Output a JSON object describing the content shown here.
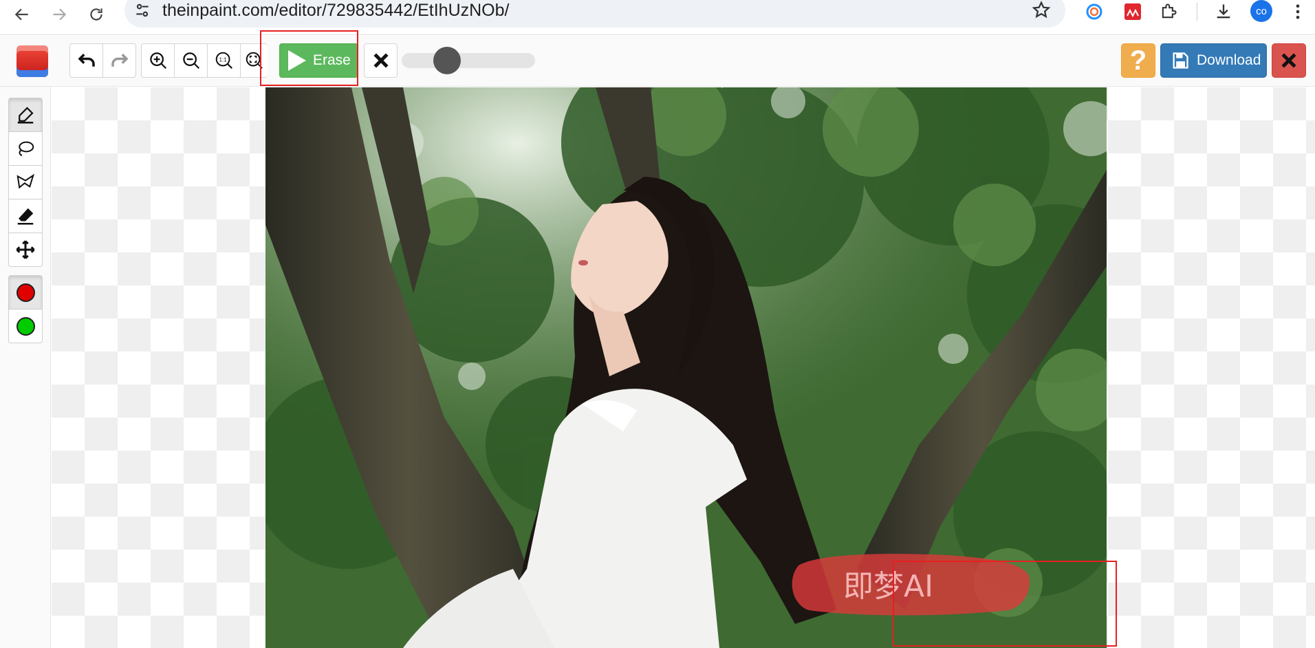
{
  "browser": {
    "url": "theinpaint.com/editor/729835442/EtIhUzNOb/",
    "profile_initials": "co"
  },
  "toolbar": {
    "erase_label": "Erase",
    "download_label": "Download",
    "help_label": "?",
    "zoom_actual_label": "1:1",
    "brush_size": 0.3
  },
  "colors": {
    "erase_button": "#5cb85c",
    "download_button": "#337ab7",
    "help_button": "#f0ad4e",
    "close_button": "#d9534f",
    "highlight_box": "#e5201f",
    "marker_red": "#e00000",
    "marker_green": "#00cc00"
  },
  "left_tools": [
    "brush",
    "lasso",
    "polygon-lasso",
    "eraser",
    "move"
  ],
  "marker_colors": [
    "red",
    "green"
  ],
  "watermark_text": "即梦AI"
}
